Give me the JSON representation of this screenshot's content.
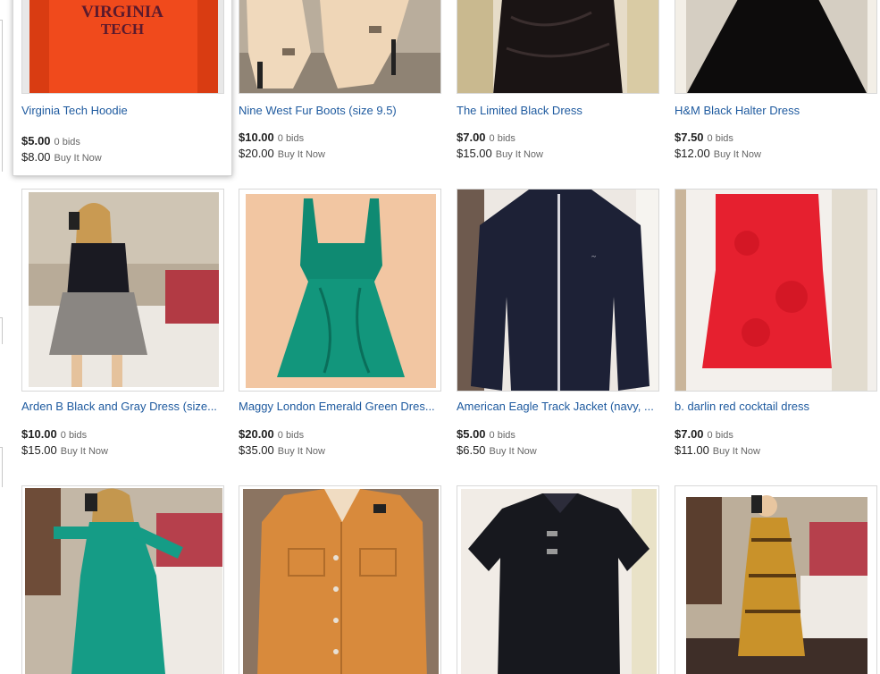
{
  "listings": [
    {
      "title": "Virginia Tech Hoodie",
      "bid_price": "$5.00",
      "bids": "0 bids",
      "bin_price": "$8.00",
      "bin_label": "Buy It Now",
      "image_text": [
        "VIRGINIA",
        "TECH"
      ]
    },
    {
      "title": "Nine West Fur Boots (size 9.5)",
      "bid_price": "$10.00",
      "bids": "0 bids",
      "bin_price": "$20.00",
      "bin_label": "Buy It Now"
    },
    {
      "title": "The Limited Black Dress",
      "bid_price": "$7.00",
      "bids": "0 bids",
      "bin_price": "$15.00",
      "bin_label": "Buy It Now"
    },
    {
      "title": "H&M Black Halter Dress",
      "bid_price": "$7.50",
      "bids": "0 bids",
      "bin_price": "$12.00",
      "bin_label": "Buy It Now"
    },
    {
      "title": "Arden B Black and Gray Dress (size...",
      "bid_price": "$10.00",
      "bids": "0 bids",
      "bin_price": "$15.00",
      "bin_label": "Buy It Now"
    },
    {
      "title": "Maggy London Emerald Green Dres...",
      "bid_price": "$20.00",
      "bids": "0 bids",
      "bin_price": "$35.00",
      "bin_label": "Buy It Now"
    },
    {
      "title": "American Eagle Track Jacket (navy, ...",
      "bid_price": "$5.00",
      "bids": "0 bids",
      "bin_price": "$6.50",
      "bin_label": "Buy It Now"
    },
    {
      "title": "b. darlin red cocktail dress",
      "bid_price": "$7.00",
      "bids": "0 bids",
      "bin_price": "$11.00",
      "bin_label": "Buy It Now"
    },
    {
      "title": "",
      "bid_price": "",
      "bids": "",
      "bin_price": "",
      "bin_label": ""
    },
    {
      "title": "",
      "bid_price": "",
      "bids": "",
      "bin_price": "",
      "bin_label": ""
    },
    {
      "title": "",
      "bid_price": "",
      "bids": "",
      "bin_price": "",
      "bin_label": ""
    },
    {
      "title": "",
      "bid_price": "",
      "bids": "",
      "bin_price": "",
      "bin_label": ""
    }
  ],
  "colors": {
    "link": "#1e5a9f",
    "price": "#222222",
    "meta": "#666666",
    "border": "#d8d8d8"
  }
}
